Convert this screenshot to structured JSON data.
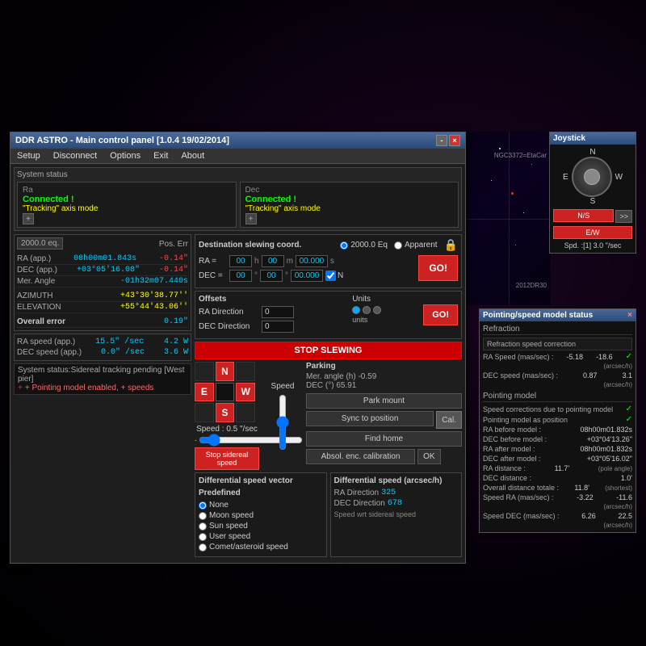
{
  "app": {
    "title": "DDR ASTRO - Main control panel  [1.0.4  19/02/2014]",
    "menu": [
      "Setup",
      "Disconnect",
      "Options",
      "Exit",
      "About"
    ]
  },
  "system_status": {
    "label": "System status",
    "ra_label": "Ra",
    "dec_label": "Dec",
    "ra_status": "Connected !",
    "dec_status": "Connected !",
    "ra_tracking": "\"Tracking\" axis mode",
    "dec_tracking": "\"Tracking\" axis mode"
  },
  "epoch": "2000.0 eq.",
  "pos_err_header": "Pos. Err",
  "coordinates": {
    "ra_app_label": "RA (app.)",
    "ra_app_value": "08h00m01.843s",
    "ra_app_err": "-0.14\"",
    "dec_app_label": "DEC (app.)",
    "dec_app_value": "+03°05'16.08\"",
    "dec_app_err": "-0.14\"",
    "mer_angle_label": "Mer. Angle",
    "mer_angle_value": "-01h32m07.440s",
    "azimuth_label": "AZIMUTH",
    "azimuth_value": "+43°30'38.77''",
    "elevation_label": "ELEVATION",
    "elevation_value": "+55°44'43.06''",
    "overall_label": "Overall error",
    "overall_value": "0.19\""
  },
  "speeds": {
    "ra_label": "RA speed (app.)",
    "ra_speed": "15.5\" /sec",
    "ra_power": "4.2 W",
    "dec_label": "DEC speed (app.)",
    "dec_speed": "0.0\" /sec",
    "dec_power": "3.6 W"
  },
  "status_bar": {
    "text": "System status:Sidereal tracking pending  [West pier]",
    "pointing_model": "+ Pointing model enabled, + speeds"
  },
  "destination": {
    "title": "Destination slewing coord.",
    "epoch_2000": "2000.0 Eq",
    "epoch_apparent": "Apparent",
    "ra_label": "RA =",
    "ra_h": "00",
    "ra_m": "00",
    "ra_s": "00.000",
    "dec_label": "DEC =",
    "dec_d": "00",
    "dec_m": "00",
    "dec_s": "00.000",
    "n_checkbox": "N",
    "go_label": "GO!"
  },
  "offsets": {
    "title": "Offsets",
    "ra_dir_label": "RA Direction",
    "ra_dir_value": "0",
    "dec_dir_label": "DEC Direction",
    "dec_dir_value": "0",
    "units_label": "Units",
    "units_text": "units",
    "go_label": "GO!"
  },
  "stop_slewing": "STOP SLEWING",
  "direction_pad": {
    "n": "N",
    "s": "S",
    "e": "E",
    "w": "W",
    "speed_label": "Speed : 0.5 \"/sec",
    "stop_sidereal": "Stop sidereal speed"
  },
  "parking": {
    "title": "Parking",
    "mer_angle": "Mer. angle (h)  -0.59",
    "dec_val": "DEC (°)  65.91",
    "park_mount": "Park mount",
    "sync_position": "Sync to position",
    "cal_label": "Cal.",
    "find_home": "Find home",
    "absol_enc": "Absol. enc. calibration",
    "ok_label": "OK"
  },
  "differential": {
    "title": "Differential speed vector",
    "predefined_title": "Predefined",
    "options": [
      "None",
      "Moon speed",
      "Sun speed",
      "User speed",
      "Comet/asteroid speed"
    ],
    "selected": "None",
    "speed_title": "Differential speed (arcsec/h)",
    "ra_dir_label": "RA Direction",
    "ra_dir_value": "325",
    "dec_dir_label": "DEC Direction",
    "dec_dir_value": "678",
    "speed_wrt": "Speed wrt sidereal speed"
  },
  "joystick": {
    "title": "Joystick",
    "n": "N",
    "s": "S",
    "e": "E",
    "w": "W",
    "ns_label": "N/S",
    "ew_label": "E/W",
    "arrow_label": ">>",
    "speed_label": "Spd. :[1] 3.0 \"/sec"
  },
  "pointing_model": {
    "title": "Pointing/speed model status",
    "refraction_title": "Refraction",
    "refraction_btn": "Refraction speed correction",
    "ra_speed_label": "RA Speed (mas/sec) :",
    "ra_speed_val1": "-5.18",
    "ra_speed_val2": "-18.6",
    "ra_speed_unit": "(arcsec/h)",
    "dec_speed_label": "DEC speed (mas/sec) :",
    "dec_speed_val1": "0.87",
    "dec_speed_val2": "3.1",
    "dec_speed_unit": "(arcsec/h)",
    "pointing_title": "Pointing model",
    "speed_corrections_label": "Speed corrections due to pointing model",
    "pointing_as_pos_label": "Pointing model as position",
    "ra_before_label": "RA before model :",
    "ra_before_value": "08h00m01.832s",
    "dec_before_label": "DEC before model :",
    "dec_before_value": "+03°04'13.26\"",
    "ra_after_label": "RA after model :",
    "ra_after_value": "08h00m01.832s",
    "dec_after_label": "DEC after model :",
    "dec_after_value": "+03°05'16.02\"",
    "ra_distance_label": "RA distance :",
    "ra_distance_value": "11.7'",
    "ra_distance_note": "(pole angle)",
    "dec_distance_label": "DEC distance :",
    "dec_distance_value": "1.0'",
    "overall_distance_label": "Overall distance totale :",
    "overall_distance_value": "11.8'",
    "overall_distance_note": "(shortest)",
    "speed_ra_label": "Speed RA (mas/sec) :",
    "speed_ra_val1": "-3.22",
    "speed_ra_val2": "-11.6",
    "speed_ra_unit": "(arcsec/h)",
    "speed_dec_label": "Speed DEC (mas/sec) :",
    "speed_dec_val1": "6.26",
    "speed_dec_val2": "22.5",
    "speed_dec_unit": "(arcsec/h)"
  },
  "colors": {
    "accent": "#cc2222",
    "connected": "#00ff00",
    "data_blue": "#00ccff",
    "warning": "#ffff00"
  }
}
